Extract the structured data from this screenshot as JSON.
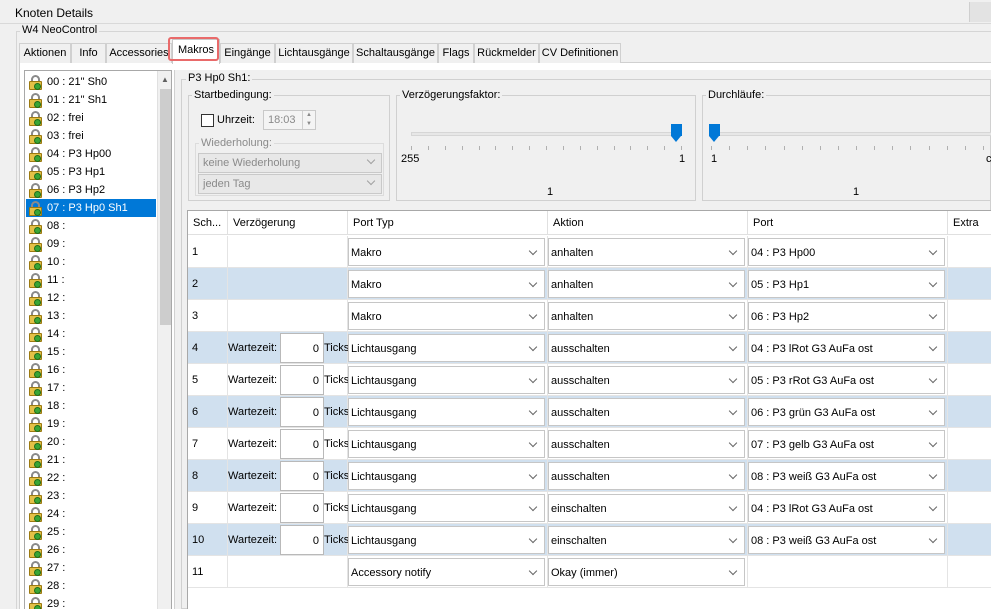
{
  "window": {
    "title": "Knoten Details"
  },
  "node": {
    "group_label": "W4 NeoControl"
  },
  "tabs": [
    {
      "label": "Aktionen"
    },
    {
      "label": "Info"
    },
    {
      "label": "Accessories"
    },
    {
      "label": "Makros"
    },
    {
      "label": "Eingänge"
    },
    {
      "label": "Lichtausgänge"
    },
    {
      "label": "Schaltausgänge"
    },
    {
      "label": "Flags"
    },
    {
      "label": "Rückmelder"
    },
    {
      "label": "CV Definitionen"
    }
  ],
  "active_tab": "Makros",
  "macro_list": [
    {
      "label": "00 : 21\" Sh0"
    },
    {
      "label": "01 : 21\" Sh1"
    },
    {
      "label": "02 : frei"
    },
    {
      "label": "03 : frei"
    },
    {
      "label": "04 : P3 Hp00"
    },
    {
      "label": "05 : P3 Hp1"
    },
    {
      "label": "06 : P3 Hp2"
    },
    {
      "label": "07 : P3 Hp0 Sh1"
    },
    {
      "label": "08 :"
    },
    {
      "label": "09 :"
    },
    {
      "label": "10 :"
    },
    {
      "label": "11 :"
    },
    {
      "label": "12 :"
    },
    {
      "label": "13 :"
    },
    {
      "label": "14 :"
    },
    {
      "label": "15 :"
    },
    {
      "label": "16 :"
    },
    {
      "label": "17 :"
    },
    {
      "label": "18 :"
    },
    {
      "label": "19 :"
    },
    {
      "label": "20 :"
    },
    {
      "label": "21 :"
    },
    {
      "label": "22 :"
    },
    {
      "label": "23 :"
    },
    {
      "label": "24 :"
    },
    {
      "label": "25 :"
    },
    {
      "label": "26 :"
    },
    {
      "label": "27 :"
    },
    {
      "label": "28 :"
    },
    {
      "label": "29 :"
    }
  ],
  "selected_index": 7,
  "macro": {
    "title": "P3 Hp0 Sh1:",
    "start": {
      "legend": "Startbedingung:",
      "time_label": "Uhrzeit:",
      "time_value": "18:03",
      "time_checked": false,
      "repeat_legend": "Wiederholung:",
      "repeat_value": "keine Wiederholung",
      "day_value": "jeden Tag"
    },
    "delay_factor": {
      "legend": "Verzögerungsfaktor:",
      "min_label": "255",
      "max_label": "1",
      "value_label": "1",
      "level": 1.0
    },
    "cycles": {
      "legend": "Durchläufe:",
      "min_label": "1",
      "max_label_partial": "c",
      "value_label": "1",
      "level": 0.0
    }
  },
  "table": {
    "columns": [
      "Sch...",
      "Verzögerung",
      "Port Typ",
      "Aktion",
      "Port",
      "Extra"
    ],
    "wait_label": "Wartezeit:",
    "wait_unit": "Ticks",
    "rows": [
      {
        "step": "1",
        "wait": null,
        "port_type": "Makro",
        "action": "anhalten",
        "port": "04 : P3 Hp00"
      },
      {
        "step": "2",
        "wait": null,
        "port_type": "Makro",
        "action": "anhalten",
        "port": "05 : P3 Hp1"
      },
      {
        "step": "3",
        "wait": null,
        "port_type": "Makro",
        "action": "anhalten",
        "port": "06 : P3 Hp2"
      },
      {
        "step": "4",
        "wait": "0",
        "port_type": "Lichtausgang",
        "action": "ausschalten",
        "port": "04 : P3 lRot G3 AuFa ost"
      },
      {
        "step": "5",
        "wait": "0",
        "port_type": "Lichtausgang",
        "action": "ausschalten",
        "port": "05 : P3 rRot G3 AuFa ost"
      },
      {
        "step": "6",
        "wait": "0",
        "port_type": "Lichtausgang",
        "action": "ausschalten",
        "port": "06 : P3 grün G3 AuFa ost"
      },
      {
        "step": "7",
        "wait": "0",
        "port_type": "Lichtausgang",
        "action": "ausschalten",
        "port": "07 : P3 gelb G3 AuFa ost"
      },
      {
        "step": "8",
        "wait": "0",
        "port_type": "Lichtausgang",
        "action": "ausschalten",
        "port": "08 : P3 weiß G3 AuFa ost"
      },
      {
        "step": "9",
        "wait": "0",
        "port_type": "Lichtausgang",
        "action": "einschalten",
        "port": "04 : P3 lRot G3 AuFa ost"
      },
      {
        "step": "10",
        "wait": "0",
        "port_type": "Lichtausgang",
        "action": "einschalten",
        "port": "08 : P3 weiß G3 AuFa ost"
      },
      {
        "step": "11",
        "wait": null,
        "port_type": "Accessory notify",
        "action": "Okay (immer)",
        "port": null
      }
    ]
  },
  "colors": {
    "selection": "#0078d7",
    "alt_row": "#d0e0ef",
    "highlight": "#e96a6a",
    "slider_thumb": "#0078d7"
  }
}
